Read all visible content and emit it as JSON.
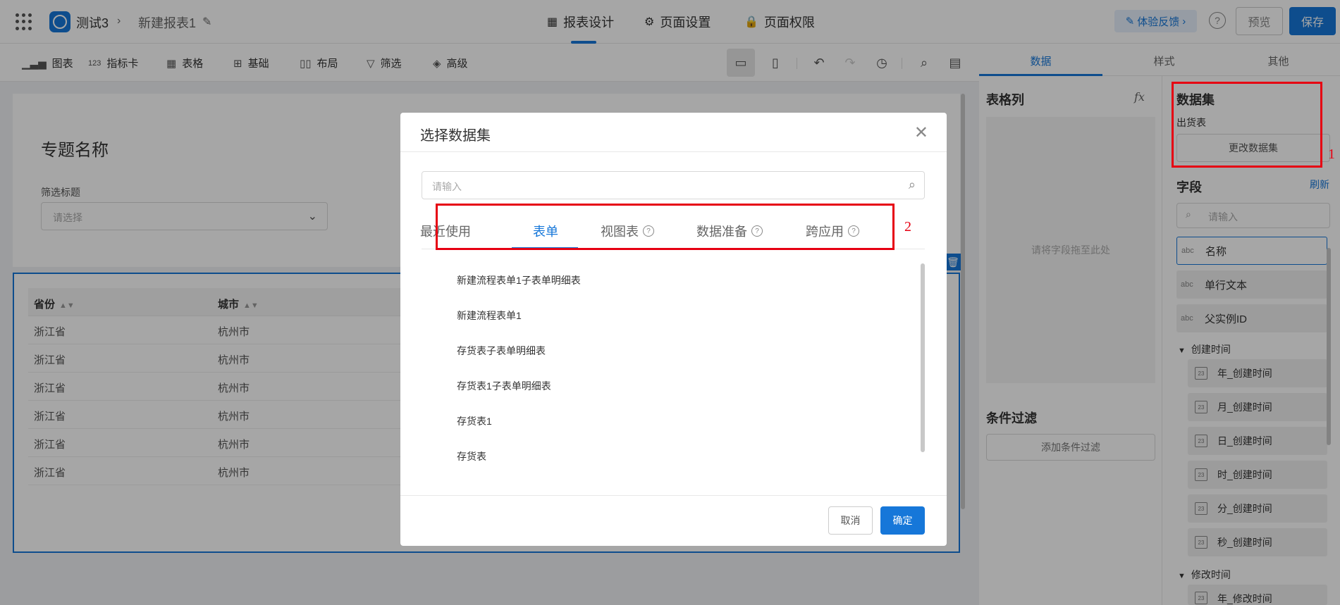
{
  "header": {
    "app_name": "测试3",
    "report_name": "新建报表1",
    "nav": [
      {
        "label": "报表设计",
        "icon": "report-design-icon"
      },
      {
        "label": "页面设置",
        "icon": "gear-icon"
      },
      {
        "label": "页面权限",
        "icon": "lock-icon"
      }
    ],
    "feedback_label": "体验反馈",
    "preview_label": "预览",
    "save_label": "保存"
  },
  "toolbar": {
    "items": [
      {
        "label": "图表",
        "icon": "bar-chart-icon"
      },
      {
        "label": "指标卡",
        "icon": "number-123-icon"
      },
      {
        "label": "表格",
        "icon": "table-icon"
      },
      {
        "label": "基础",
        "icon": "grid-icon"
      },
      {
        "label": "布局",
        "icon": "layout-icon"
      },
      {
        "label": "筛选",
        "icon": "filter-icon"
      },
      {
        "label": "高级",
        "icon": "layers-icon"
      }
    ]
  },
  "canvas": {
    "topic_title": "专题名称",
    "filter_label": "筛选标题",
    "filter_placeholder": "请选择",
    "table": {
      "columns": [
        "省份",
        "城市"
      ],
      "rows": [
        [
          "浙江省",
          "杭州市"
        ],
        [
          "浙江省",
          "杭州市"
        ],
        [
          "浙江省",
          "杭州市"
        ],
        [
          "浙江省",
          "杭州市"
        ],
        [
          "浙江省",
          "杭州市"
        ],
        [
          "浙江省",
          "杭州市"
        ]
      ]
    }
  },
  "right_panel": {
    "tabs": [
      "数据",
      "样式",
      "其他"
    ],
    "active_tab": "数据",
    "table_columns_title": "表格列",
    "fx_label": "fx",
    "drop_hint": "请将字段拖至此处",
    "condition_title": "条件过滤",
    "add_condition_label": "添加条件过滤",
    "dataset_title": "数据集",
    "dataset_name": "出货表",
    "change_dataset_label": "更改数据集",
    "fields_title": "字段",
    "refresh_label": "刷新",
    "field_search_placeholder": "请输入",
    "fields": [
      {
        "type": "abc",
        "name": "名称"
      },
      {
        "type": "abc",
        "name": "单行文本"
      },
      {
        "type": "abc",
        "name": "父实例ID"
      }
    ],
    "groups": [
      {
        "name": "创建时间",
        "fields": [
          "年_创建时间",
          "月_创建时间",
          "日_创建时间",
          "时_创建时间",
          "分_创建时间",
          "秒_创建时间"
        ]
      },
      {
        "name": "修改时间",
        "fields": [
          "年_修改时间"
        ]
      }
    ],
    "date_icon_text": "23"
  },
  "modal": {
    "title": "选择数据集",
    "search_placeholder": "请输入",
    "tabs": [
      {
        "label": "最近使用",
        "help": false
      },
      {
        "label": "表单",
        "help": false
      },
      {
        "label": "视图表",
        "help": true
      },
      {
        "label": "数据准备",
        "help": true
      },
      {
        "label": "跨应用",
        "help": true
      }
    ],
    "active_tab": "表单",
    "items": [
      "新建流程表单1子表单明细表",
      "新建流程表单1",
      "存货表子表单明细表",
      "存货表1子表单明细表",
      "存货表1",
      "存货表"
    ],
    "cancel_label": "取消",
    "ok_label": "确定"
  },
  "annotations": [
    "1",
    "2"
  ],
  "colors": {
    "accent": "#1677d9",
    "annotation": "#e60012"
  }
}
